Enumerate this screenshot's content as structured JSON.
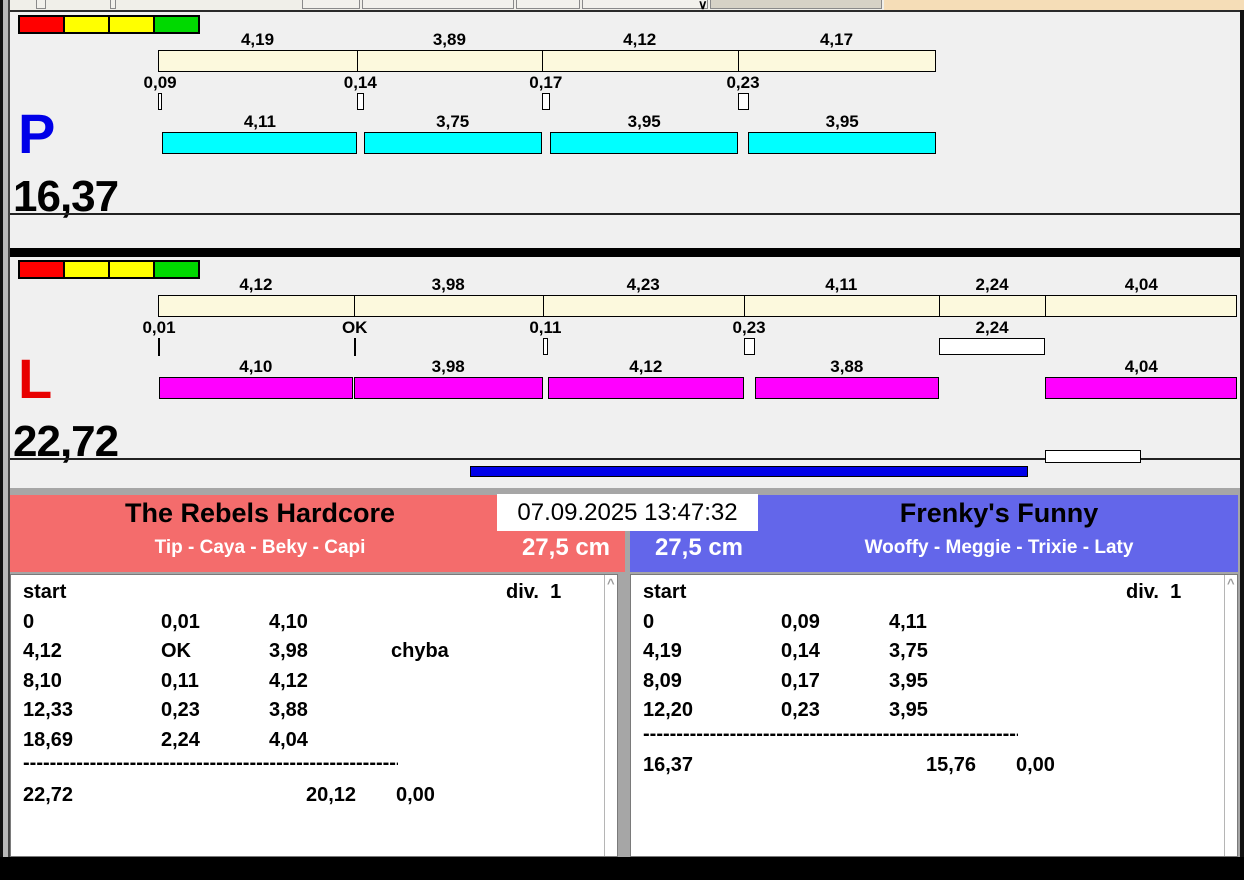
{
  "datetime": "07.09.2025 13:47:32",
  "lanes": [
    {
      "id": "P",
      "letter": "P",
      "letter_color": "#0000e8",
      "total_label": "16,37",
      "total_seconds": 16.37,
      "run_bar_color": "#00ffff",
      "split_bar_color": "#fcf9dd",
      "traffic_lights": [
        "#ff0000",
        "#ffff00",
        "#ffff00",
        "#00d900"
      ],
      "splits": [
        {
          "label": "4,19",
          "value": 4.19
        },
        {
          "label": "3,89",
          "value": 3.89
        },
        {
          "label": "4,12",
          "value": 4.12
        },
        {
          "label": "4,17",
          "value": 4.17
        }
      ],
      "markers": [
        {
          "label": "0,09",
          "time": 0,
          "width": 0.09
        },
        {
          "label": "0,14",
          "time": 4.19,
          "width": 0.14
        },
        {
          "label": "0,17",
          "time": 8.08,
          "width": 0.17
        },
        {
          "label": "0,23",
          "time": 12.2,
          "width": 0.23
        }
      ],
      "runs": [
        {
          "label": "4,11",
          "start": 0.09,
          "value": 4.11
        },
        {
          "label": "3,75",
          "start": 4.33,
          "value": 3.75
        },
        {
          "label": "3,95",
          "start": 8.26,
          "value": 3.95
        },
        {
          "label": "3,95",
          "start": 12.43,
          "value": 3.95
        }
      ]
    },
    {
      "id": "L",
      "letter": "L",
      "letter_color": "#e80000",
      "total_label": "22,72",
      "total_seconds": 22.72,
      "run_bar_color": "#ff00ff",
      "split_bar_color": "#fcf9dd",
      "traffic_lights": [
        "#ff0000",
        "#ffff00",
        "#ffff00",
        "#00d900"
      ],
      "splits": [
        {
          "label": "4,12",
          "value": 4.12
        },
        {
          "label": "3,98",
          "value": 3.98
        },
        {
          "label": "4,23",
          "value": 4.23
        },
        {
          "label": "4,11",
          "value": 4.11
        },
        {
          "label": "2,24",
          "value": 2.24
        },
        {
          "label": "4,04",
          "value": 4.04
        }
      ],
      "markers": [
        {
          "label": "0,01",
          "time": 0,
          "width": 0.01
        },
        {
          "label": "OK",
          "time": 4.12,
          "width": 0
        },
        {
          "label": "0,11",
          "time": 8.1,
          "width": 0.11
        },
        {
          "label": "0,23",
          "time": 12.33,
          "width": 0.23
        },
        {
          "label": "2,24",
          "time": 16.44,
          "width": 2.24
        }
      ],
      "runs": [
        {
          "label": "4,10",
          "start": 0.01,
          "value": 4.1
        },
        {
          "label": "3,98",
          "start": 4.12,
          "value": 3.98
        },
        {
          "label": "4,12",
          "start": 8.21,
          "value": 4.12
        },
        {
          "label": "3,88",
          "start": 12.56,
          "value": 3.88
        },
        {
          "label": "4,04",
          "start": 18.68,
          "value": 4.04
        }
      ]
    }
  ],
  "progress_bar_color": "#0000e8",
  "teams": [
    {
      "side": "left",
      "name": "The Rebels Hardcore",
      "dogs": "Tip - Caya - Beky - Capi",
      "jump_height": "27,5 cm",
      "color": "#f46c6c",
      "table": {
        "head_left": "start",
        "head_right": "div.  1",
        "rows": [
          [
            "0",
            "0,01",
            "4,10",
            ""
          ],
          [
            "4,12",
            "OK",
            "3,98",
            "chyba"
          ],
          [
            "8,10",
            "0,11",
            "4,12",
            ""
          ],
          [
            "12,33",
            "0,23",
            "3,88",
            ""
          ],
          [
            "18,69",
            "2,24",
            "4,04",
            ""
          ]
        ],
        "totals": [
          "22,72",
          "",
          "20,12",
          "0,00"
        ]
      }
    },
    {
      "side": "right",
      "name": "Frenky's Funny",
      "dogs": "Wooffy - Meggie - Trixie - Laty",
      "jump_height": "27,5 cm",
      "color": "#6366ea",
      "table": {
        "head_left": "start",
        "head_right": "div.  1",
        "rows": [
          [
            "0",
            "0,09",
            "4,11",
            ""
          ],
          [
            "4,19",
            "0,14",
            "3,75",
            ""
          ],
          [
            "8,09",
            "0,17",
            "3,95",
            ""
          ],
          [
            "12,20",
            "0,23",
            "3,95",
            ""
          ]
        ],
        "totals": [
          "16,37",
          "",
          "15,76",
          "0,00"
        ]
      }
    }
  ]
}
